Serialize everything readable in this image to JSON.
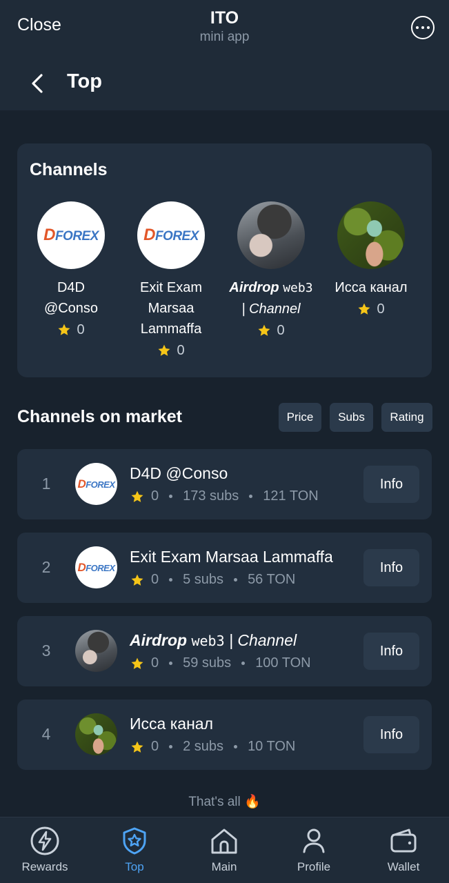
{
  "header": {
    "close_label": "Close",
    "app_title": "ITO",
    "app_subtitle": "mini app",
    "page_title": "Top"
  },
  "channels_card": {
    "heading": "Channels",
    "items": [
      {
        "name_line1": "D4D",
        "name_line2": "@Conso",
        "name_line3": "",
        "rating": "0",
        "avatar": "forex-logo"
      },
      {
        "name_line1": "Exit Exam",
        "name_line2": "Marsaa",
        "name_line3": "Lammaffa",
        "rating": "0",
        "avatar": "forex-logo"
      },
      {
        "name_bold_italic": "Airdrop",
        "name_mono": "web3",
        "name_italic": "| Channel",
        "rating": "0",
        "avatar": "person-photo"
      },
      {
        "name_line1": "Исса канал",
        "rating": "0",
        "avatar": "plant-photo"
      }
    ]
  },
  "market": {
    "heading": "Channels on market",
    "sort_buttons": [
      "Price",
      "Subs",
      "Rating"
    ],
    "rows": [
      {
        "rank": "1",
        "title": "D4D @Conso",
        "rating": "0",
        "subs": "173 subs",
        "price": "121 TON",
        "info_label": "Info",
        "avatar": "forex-logo"
      },
      {
        "rank": "2",
        "title": "Exit Exam Marsaa Lammaffa",
        "rating": "0",
        "subs": "5 subs",
        "price": "56 TON",
        "info_label": "Info",
        "avatar": "forex-logo"
      },
      {
        "rank": "3",
        "title_bold_italic": "Airdrop",
        "title_mono": "web3",
        "title_italic": "| Channel",
        "rating": "0",
        "subs": "59 subs",
        "price": "100 TON",
        "info_label": "Info",
        "avatar": "person-photo"
      },
      {
        "rank": "4",
        "title": "Исса канал",
        "rating": "0",
        "subs": "2 subs",
        "price": "10 TON",
        "info_label": "Info",
        "avatar": "plant-photo"
      }
    ],
    "footer_text": "That's all 🔥"
  },
  "bottom_nav": {
    "items": [
      {
        "label": "Rewards",
        "icon": "lightning-icon",
        "active": false
      },
      {
        "label": "Top",
        "icon": "shield-star-icon",
        "active": true
      },
      {
        "label": "Main",
        "icon": "home-icon",
        "active": false
      },
      {
        "label": "Profile",
        "icon": "person-icon",
        "active": false
      },
      {
        "label": "Wallet",
        "icon": "wallet-icon",
        "active": false
      }
    ]
  },
  "colors": {
    "background": "#18222d",
    "card": "#222f3e",
    "button": "#2b3a4b",
    "accent": "#4ea4f5",
    "star": "#f5c518",
    "muted": "#8d9aa8"
  }
}
